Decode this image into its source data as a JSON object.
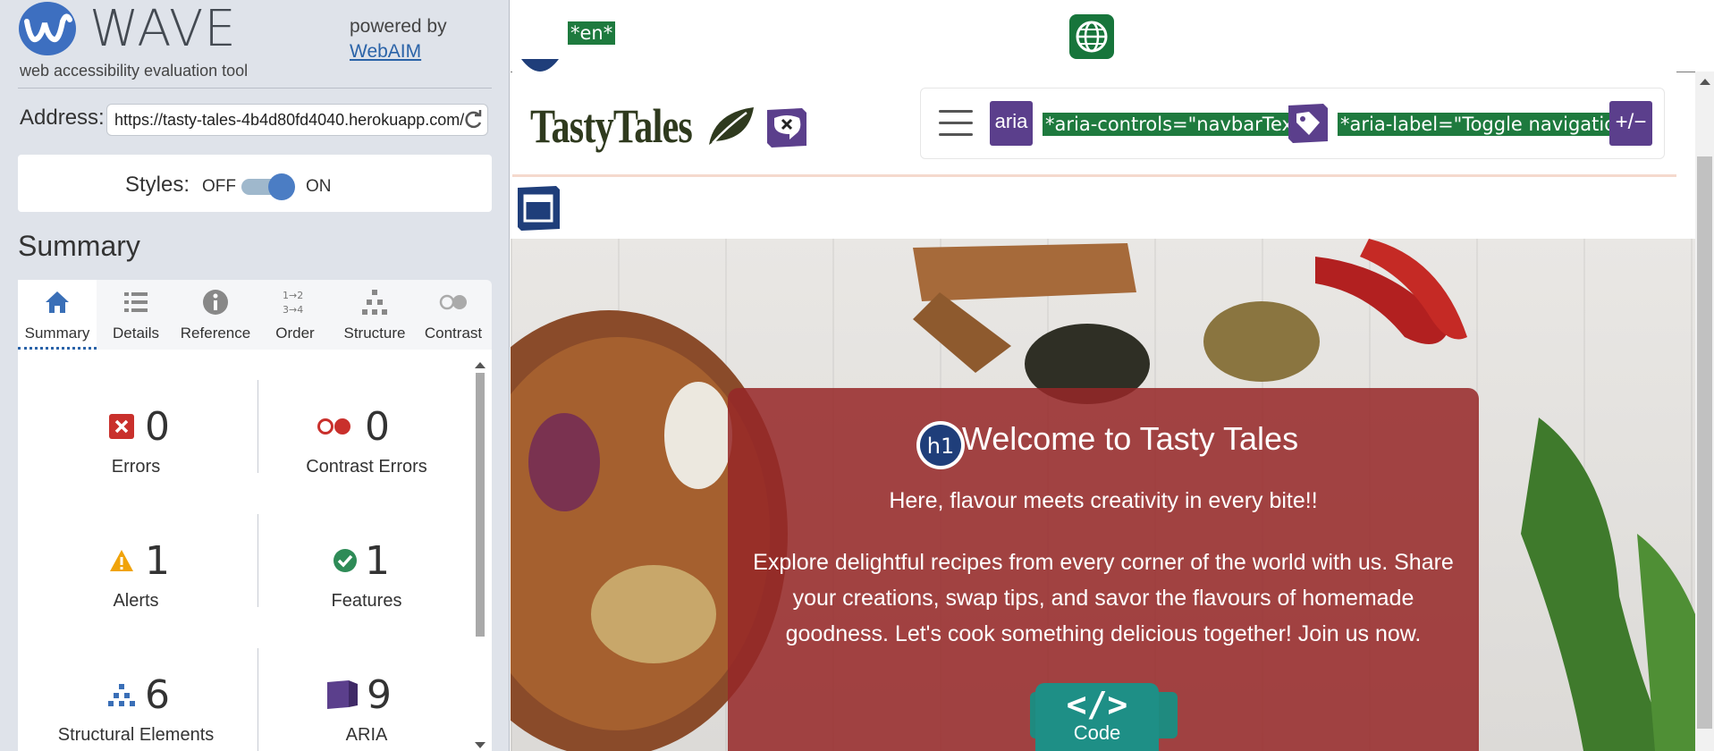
{
  "wave": {
    "logo_text": "WAVE",
    "tagline": "web accessibility evaluation tool",
    "powered_by": "powered by",
    "webaim_link": "WebAIM",
    "address_label": "Address:",
    "address_value": "https://tasty-tales-4b4d80fd4040.herokuapp.com/",
    "styles_label": "Styles:",
    "styles_off": "OFF",
    "styles_on": "ON",
    "styles_enabled": true,
    "summary_heading": "Summary",
    "tabs": [
      {
        "label": "Summary",
        "icon": "home-icon",
        "active": true
      },
      {
        "label": "Details",
        "icon": "list-icon"
      },
      {
        "label": "Reference",
        "icon": "info-icon"
      },
      {
        "label": "Order",
        "icon": "order-icon"
      },
      {
        "label": "Structure",
        "icon": "structure-icon"
      },
      {
        "label": "Contrast",
        "icon": "contrast-icon"
      }
    ],
    "stats": {
      "errors": {
        "value": "0",
        "label": "Errors",
        "color": "#c9302c"
      },
      "contrast_errors": {
        "value": "0",
        "label": "Contrast Errors",
        "color": "#c9302c"
      },
      "alerts": {
        "value": "1",
        "label": "Alerts",
        "color": "#f0a30a"
      },
      "features": {
        "value": "1",
        "label": "Features",
        "color": "#2e8b57"
      },
      "structural": {
        "value": "6",
        "label": "Structural Elements",
        "color": "#3a6fb7"
      },
      "aria": {
        "value": "9",
        "label": "ARIA",
        "color": "#5b3f8c"
      }
    }
  },
  "page": {
    "lang_tag": "*en*",
    "brand": "TastyTales",
    "aria_badge": "aria",
    "aria_controls": "*aria-controls=\"navbarText\"*",
    "aria_label": "*aria-label=\"Toggle navigation\"*",
    "plusminus_badge": "+/−",
    "h1_badge": "h1",
    "hero_title": "Welcome to Tasty Tales",
    "hero_sub": "Here, flavour meets creativity in every bite!!",
    "hero_desc": "Explore delightful recipes from every corner of the world with us. Share your creations, swap tips, and savor the flavours of homemade goodness. Let's cook something delicious together! Join us now.",
    "code_glyph": "</>",
    "code_label": "Code",
    "colors": {
      "wave_green": "#1e7a3e",
      "wave_purple": "#5b3f8c",
      "hero_overlay": "#962828",
      "code_teal": "#1e8f86"
    }
  }
}
